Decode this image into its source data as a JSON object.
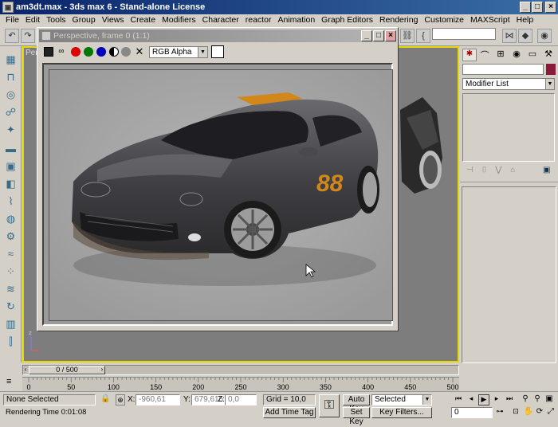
{
  "window": {
    "title": "am3dt.max - 3ds max 6 - Stand-alone License"
  },
  "menu": [
    "File",
    "Edit",
    "Tools",
    "Group",
    "Views",
    "Create",
    "Modifiers",
    "Character",
    "reactor",
    "Animation",
    "Graph Editors",
    "Rendering",
    "Customize",
    "MAXScript",
    "Help"
  ],
  "viewport": {
    "label": "Pers"
  },
  "render_frame": {
    "title": "Perspective, frame 0 (1:1)",
    "channel_select": "RGB Alpha",
    "car_number": "88"
  },
  "command_panel": {
    "modifier_list": "Modifier List"
  },
  "timeline": {
    "frame_counter": "0 / 500",
    "ticks": [
      "0",
      "50",
      "100",
      "150",
      "200",
      "250",
      "300",
      "350",
      "400",
      "450",
      "500"
    ]
  },
  "status": {
    "selection": "None Selected",
    "rendering_time": "Rendering Time  0:01:08",
    "x_label": "X:",
    "x_value": "-960,61",
    "y_label": "Y:",
    "y_value": "679,615",
    "z_label": "Z:",
    "z_value": "0,0",
    "grid": "Grid = 10,0",
    "add_time_tag": "Add Time Tag",
    "auto_key": "Auto Key",
    "set_key": "Set Key",
    "selected_dropdown": "Selected",
    "key_filters": "Key Filters...",
    "frame_field": "0"
  }
}
